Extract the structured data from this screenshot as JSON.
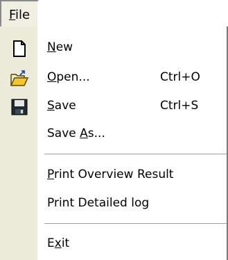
{
  "menubar": {
    "file": {
      "pre": "",
      "mnemonic": "F",
      "post": "ile"
    }
  },
  "menu": {
    "new": {
      "pre": "",
      "mnemonic": "N",
      "post": "ew",
      "icon": "new-document-icon"
    },
    "open": {
      "pre": "",
      "mnemonic": "O",
      "post": "pen...",
      "shortcut": "Ctrl+O",
      "icon": "open-folder-icon"
    },
    "save": {
      "pre": "",
      "mnemonic": "S",
      "post": "ave",
      "shortcut": "Ctrl+S",
      "icon": "floppy-disk-icon"
    },
    "saveas": {
      "pre": "Save ",
      "mnemonic": "A",
      "post": "s..."
    },
    "print_overview": {
      "pre": "",
      "mnemonic": "P",
      "post": "rint Overview Result"
    },
    "print_detailed": {
      "pre": "Print Detailed log",
      "mnemonic": "",
      "post": ""
    },
    "exit": {
      "pre": "E",
      "mnemonic": "x",
      "post": "it"
    }
  },
  "colors": {
    "gutter": "#ecead8",
    "separator": "#a0a0a0"
  }
}
